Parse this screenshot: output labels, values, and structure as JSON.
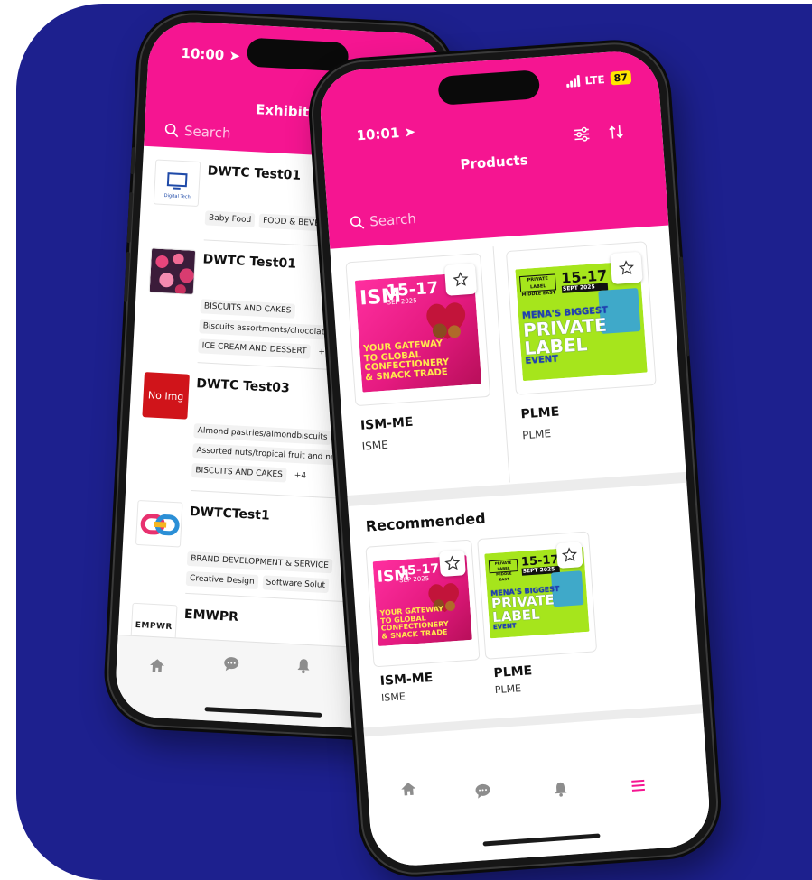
{
  "colors": {
    "backdrop": "#1d208e",
    "header_pink": "#f51591",
    "battery": "#ffe600"
  },
  "exhibitors_screen": {
    "time": "10:00",
    "title": "Exhibitors",
    "search_placeholder": "Search",
    "items": [
      {
        "name": "DWTC Test01",
        "logo": "digital-tech-logo",
        "chip_rows": [
          [
            "Baby Food",
            "FOOD & BEVERAGE"
          ]
        ],
        "more": ""
      },
      {
        "name": "DWTC Test01",
        "logo": "flower-photo",
        "chip_rows": [
          [
            "BISCUITS AND CAKES"
          ],
          [
            "Biscuits assortments/chocolate co"
          ],
          [
            "ICE CREAM AND DESSERT"
          ]
        ],
        "more": "+2"
      },
      {
        "name": "DWTC Test03",
        "logo_text": "No Img",
        "chip_rows": [
          [
            "Almond pastries/almondbiscuits"
          ],
          [
            "Assorted nuts/tropical fruit and nu"
          ],
          [
            "BISCUITS AND CAKES"
          ]
        ],
        "more": "+4"
      },
      {
        "name": "DWTCTest1",
        "logo": "chain-link-logo",
        "chip_rows": [
          [
            "BRAND DEVELOPMENT & SERVICE"
          ],
          [
            "Creative Design",
            "Software Solut"
          ]
        ],
        "more": ""
      },
      {
        "name": "EMWPR",
        "logo_text": "EMPWR",
        "chip_rows": [],
        "more": ""
      }
    ],
    "tabs": [
      "home-icon",
      "chat-icon",
      "bell-icon"
    ]
  },
  "products_screen": {
    "time": "10:01",
    "network": "LTE",
    "battery": "87",
    "title": "Products",
    "search_placeholder": "Search",
    "products": [
      {
        "name": "ISM-ME",
        "sub": "ISME",
        "banner": "ism"
      },
      {
        "name": "PLME",
        "sub": "PLME",
        "banner": "plme"
      }
    ],
    "recommended_title": "Recommended",
    "recommended": [
      {
        "name": "ISM-ME",
        "sub": "ISME",
        "banner": "ism"
      },
      {
        "name": "PLME",
        "sub": "PLME",
        "banner": "plme"
      }
    ],
    "tabs": [
      "home-icon",
      "chat-icon",
      "bell-icon",
      "menu-icon"
    ],
    "active_tab_color": "#f51591"
  },
  "banners": {
    "ism": {
      "logo": "ISM",
      "date": "15-17",
      "date_sub": "SEP 2025",
      "tag_lines": [
        "YOUR GATEWAY",
        "TO GLOBAL",
        "CONFECTIONERY",
        "& SNACK TRADE"
      ]
    },
    "plme": {
      "logo_lines": [
        "PRIVATE LABEL",
        "MIDDLE EAST"
      ],
      "date": "15-17",
      "date_sub": "SEPT 2025",
      "tag": "MENA'S BIGGEST",
      "big_lines": [
        "PRIVATE",
        "LABEL"
      ],
      "event": "EVENT"
    }
  }
}
